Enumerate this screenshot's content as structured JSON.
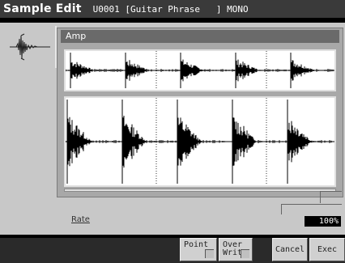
{
  "title": {
    "name": "Sample Edit",
    "info": "U0001 [Guitar Phrase   ] MONO"
  },
  "wave": {
    "header": "Amp"
  },
  "rate": {
    "label": "Rate",
    "value": "100%"
  },
  "buttons": {
    "point": "Point",
    "overwrite": "Over\nWrite",
    "cancel": "Cancel",
    "exec": "Exec"
  },
  "colors": {
    "title_bar": "#3a3a3a",
    "panel": "#c8c8c8",
    "header": "#6a6a6a",
    "waveform": "#000000"
  },
  "icons": {
    "sample": "waveform-icon"
  }
}
